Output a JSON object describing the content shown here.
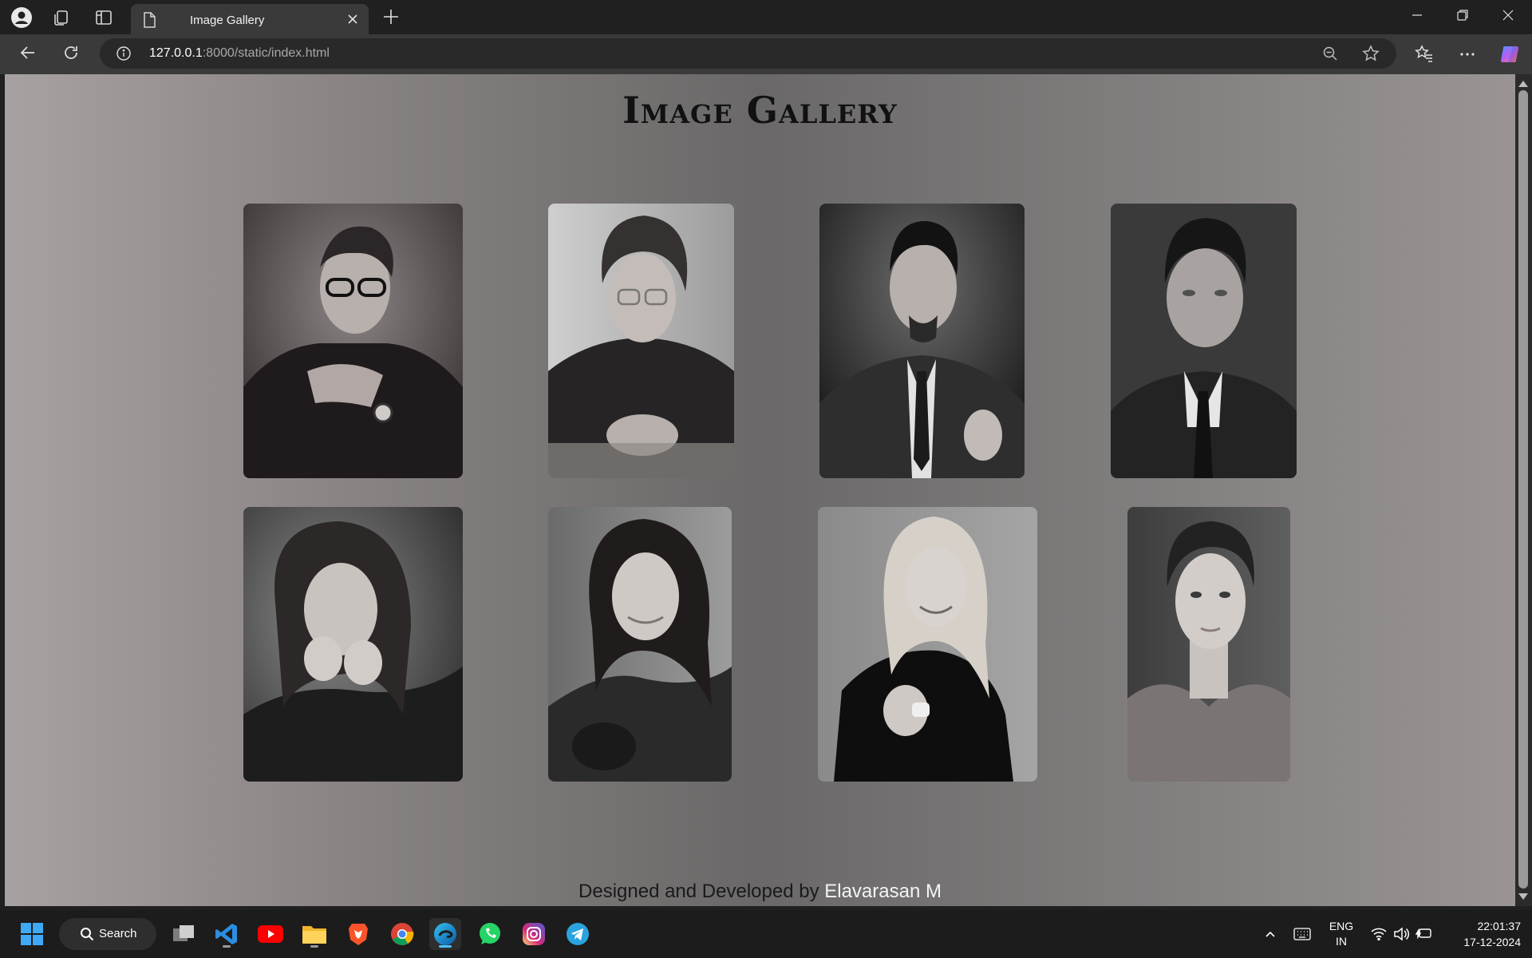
{
  "browser": {
    "tab_title": "Image Gallery",
    "url_host": "127.0.0.1",
    "url_path": ":8000/static/index.html"
  },
  "page": {
    "title": "Image Gallery",
    "footer_prefix": "Designed and Developed by ",
    "footer_author": "Elavarasan M",
    "gallery": [
      {
        "alt": "man-glasses-portrait"
      },
      {
        "alt": "young-man-glasses-portrait"
      },
      {
        "alt": "man-suit-goatee-portrait"
      },
      {
        "alt": "man-suit-tie-portrait"
      },
      {
        "alt": "woman-hands-chin-portrait"
      },
      {
        "alt": "woman-wavy-hair-portrait"
      },
      {
        "alt": "woman-blonde-smiling-portrait"
      },
      {
        "alt": "woman-hair-up-portrait"
      }
    ]
  },
  "taskbar": {
    "search_label": "Search",
    "lang_line1": "ENG",
    "lang_line2": "IN",
    "time": "22:01:37",
    "date": "17-12-2024"
  },
  "icons": [
    "profile-icon",
    "collections-icon",
    "tab-actions-icon",
    "page-icon",
    "close-icon",
    "plus-icon",
    "minimize-icon",
    "restore-icon",
    "window-close-icon",
    "back-icon",
    "refresh-icon",
    "info-icon",
    "zoom-out-icon",
    "favorite-star-icon",
    "favorites-icon",
    "more-icon",
    "copilot-icon",
    "windows-start-icon",
    "search-icon",
    "task-view-icon",
    "vscode-icon",
    "youtube-icon",
    "file-explorer-icon",
    "brave-icon",
    "chrome-icon",
    "edge-icon",
    "whatsapp-icon",
    "instagram-icon",
    "telegram-icon",
    "chevron-up-icon",
    "keyboard-icon",
    "wifi-icon",
    "volume-icon",
    "battery-icon"
  ]
}
